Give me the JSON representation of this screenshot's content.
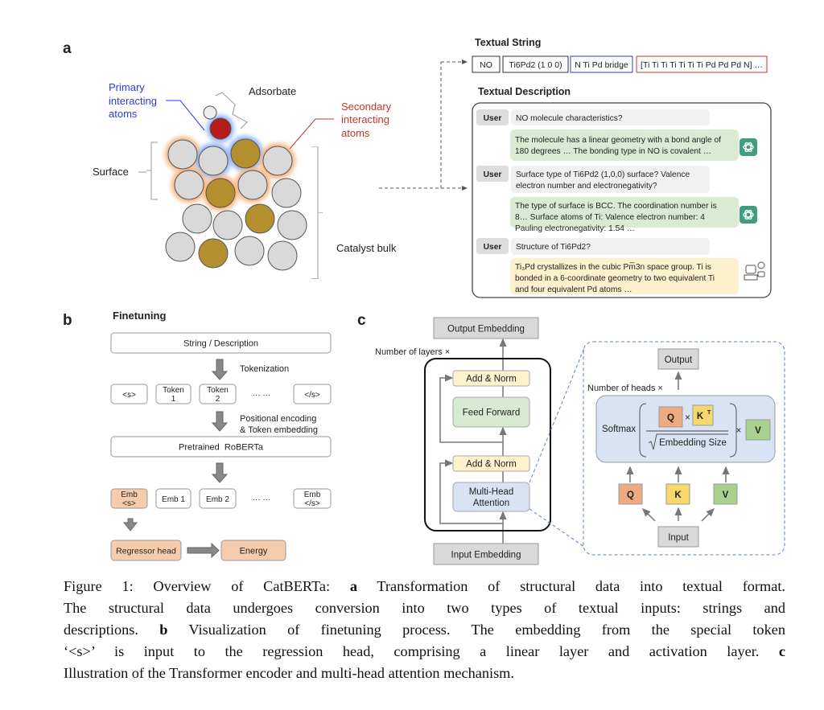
{
  "colors": {
    "primary": "#2b3be0",
    "secondary": "#c0392b",
    "atom_gray": "#d9d9d9",
    "atom_gold": "#b38f2f",
    "atom_red": "#b71c1c",
    "user_bubble": "#f1f1f1",
    "gpt_bubble": "#dbead3",
    "mp_bubble": "#fdf0cc",
    "gpt_icon": "#3f9e7e",
    "norm": "#fff2cc",
    "ff": "#d9ead3",
    "mha": "#dae3f3",
    "emb": "#d9d9d9",
    "q": "#eeaa80",
    "k": "#f7d86a",
    "v": "#a9d18e",
    "token_fill": "#f6cdac"
  },
  "panel_a": {
    "label": "a",
    "primary_label": [
      "Primary",
      "interacting",
      "atoms"
    ],
    "adsorbate_label": "Adsorbate",
    "secondary_label": [
      "Secondary",
      "interacting",
      "atoms"
    ],
    "surface_label": "Surface",
    "bulk_label": "Catalyst bulk",
    "textual_string_title": "Textual String",
    "string_tokens": [
      "NO",
      "Ti6Pd2 (1 0 0)",
      "N Ti Pd bridge",
      "[Ti Ti Ti Ti Ti Ti Ti Pd Pd Pd N] …"
    ],
    "textual_description_title": "Textual Description",
    "user_tag": "User",
    "chat": [
      {
        "q": [
          "NO molecule characteristics?"
        ],
        "a": [
          "The molecule has a linear geometry with a bond angle of",
          "180 degrees … The bonding type in NO is covalent …"
        ],
        "icon": "chatgpt-icon"
      },
      {
        "q": [
          "Surface type of Ti6Pd2 (1,0,0) surface? Valence",
          "electron number and electronegativity?"
        ],
        "a": [
          "The type of surface is BCC. The coordination number is",
          "8… Surface atoms of Ti: Valence electron number: 4",
          "Pauling electronegativity: 1.54 …"
        ],
        "icon": "chatgpt-icon"
      },
      {
        "q": [
          "Structure of Ti6Pd2?"
        ],
        "a": [
          "Ti₃Pd crystallizes in the cubic Pm̅3n space group. Ti is",
          "bonded in a 6-coordinate geometry to two equivalent Ti",
          "and four equivalent Pd atoms …"
        ],
        "icon": "robot-icon"
      }
    ]
  },
  "panel_b": {
    "label": "b",
    "title": "Finetuning",
    "input": "String / Description",
    "tokenization": "Tokenization",
    "tokens": [
      [
        "<s>"
      ],
      [
        "Token",
        "1"
      ],
      [
        "Token",
        "2"
      ],
      [
        "··· ···"
      ],
      [
        "</s>"
      ]
    ],
    "encoding": [
      "Positional encoding",
      "& Token embedding"
    ],
    "model": "Pretrained  RoBERTa",
    "embs": [
      [
        "Emb",
        "<s>"
      ],
      [
        "Emb 1"
      ],
      [
        "Emb 2"
      ],
      [
        "··· ···"
      ],
      [
        "Emb",
        "</s>"
      ]
    ],
    "head": "Regressor head",
    "output": "Energy"
  },
  "panel_c": {
    "label": "c",
    "output_embedding": "Output Embedding",
    "layers": "Number of layers ×",
    "add_norm": "Add & Norm",
    "feed_forward": "Feed Forward",
    "mha": [
      "Multi-Head",
      "Attention"
    ],
    "input_embedding": "Input Embedding",
    "output": "Output",
    "heads": "Number of heads ×",
    "softmax": "Softmax",
    "q": "Q",
    "k": "K",
    "kt_sup": "T",
    "v": "V",
    "times": "×",
    "embedding_size": "Embedding Size",
    "input": "Input"
  },
  "caption": {
    "lines": [
      [
        "Figure 1: Overview of CatBERTa: ",
        "a",
        " Transformation of structural data into textual format."
      ],
      [
        "The structural data undergoes conversion into two types of textual inputs:  strings and"
      ],
      [
        "descriptions. ",
        "b",
        " Visualization of finetuning process. The embedding from the special token"
      ],
      [
        "‘<s>’ is input to the regression head, comprising a linear layer and activation layer. ",
        "c"
      ],
      [
        "Illustration of the Transformer encoder and multi-head attention mechanism."
      ]
    ]
  }
}
